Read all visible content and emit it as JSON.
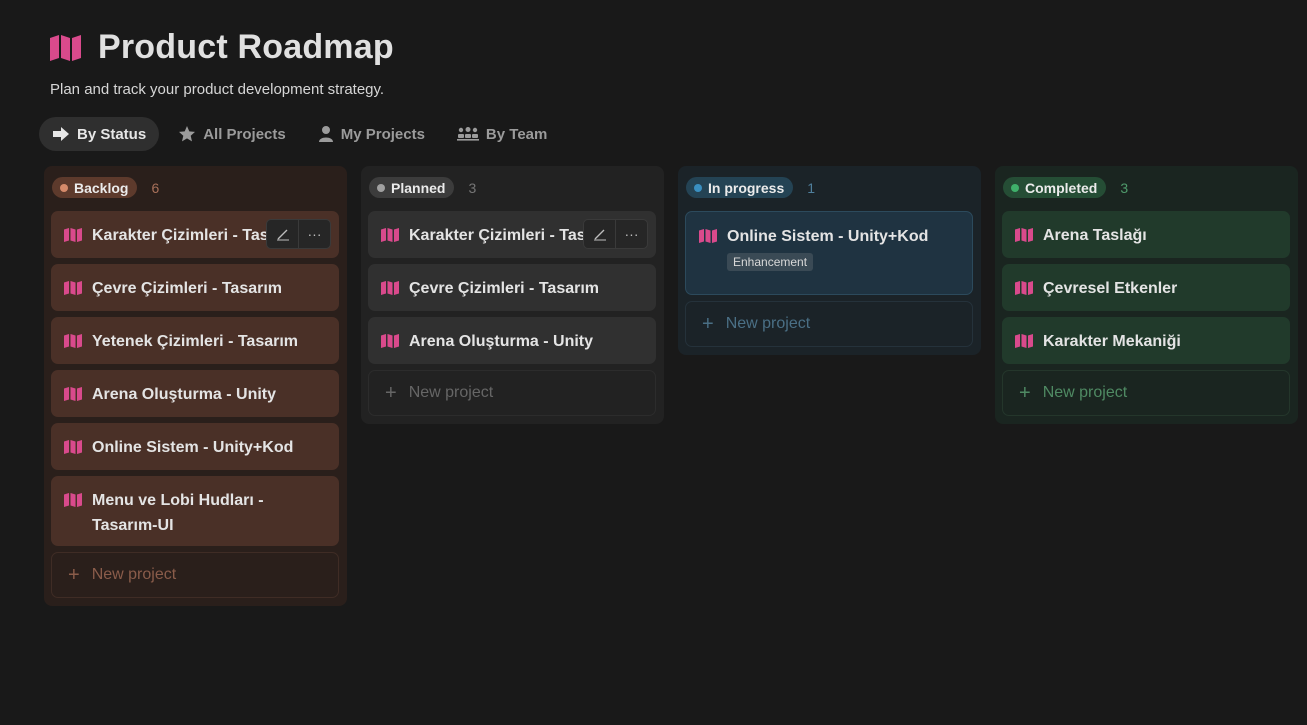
{
  "page": {
    "title": "Product Roadmap",
    "subtitle": "Plan and track your product development strategy.",
    "title_icon": "map-icon"
  },
  "views": [
    {
      "label": "By Status",
      "icon": "arrow-right-icon",
      "active": true
    },
    {
      "label": "All Projects",
      "icon": "star-icon",
      "active": false
    },
    {
      "label": "My Projects",
      "icon": "person-icon",
      "active": false
    },
    {
      "label": "By Team",
      "icon": "team-icon",
      "active": false
    }
  ],
  "columns": [
    {
      "name": "Backlog",
      "count": "6",
      "colors": {
        "bg": "#2a1f1b",
        "pill": "#5d3a2c",
        "dot": "#d58a6a",
        "card": "#4a3027",
        "count": "#a8705a",
        "new": "#8a5c4a",
        "newBorder": "#3f2c25"
      },
      "cards": [
        {
          "title": "Karakter Çizimleri - Tasarım",
          "hover": true
        },
        {
          "title": "Çevre Çizimleri - Tasarım"
        },
        {
          "title": " Yetenek Çizimleri - Tasarım"
        },
        {
          "title": "Arena Oluşturma - Unity"
        },
        {
          "title": "Online Sistem - Unity+Kod"
        },
        {
          "title": "Menu ve Lobi Hudları - Tasarım-UI",
          "wrap": true
        }
      ],
      "new_label": "New project"
    },
    {
      "name": "Planned",
      "count": "3",
      "colors": {
        "bg": "#222222",
        "pill": "#3c3c3c",
        "dot": "#a0a0a0",
        "card": "#303030",
        "count": "#767676",
        "new": "#666666",
        "newBorder": "#2c2c2c"
      },
      "cards": [
        {
          "title": "Karakter Çizimleri - Tasarım",
          "hover": true
        },
        {
          "title": "Çevre Çizimleri - Tasarım"
        },
        {
          "title": "Arena Oluşturma - Unity"
        }
      ],
      "new_label": "New project"
    },
    {
      "name": "In progress",
      "count": "1",
      "colors": {
        "bg": "#1b2328",
        "pill": "#244354",
        "dot": "#3a8fc0",
        "card": "#1f3341",
        "count": "#4f7f9c",
        "new": "#4a6f85",
        "newBorder": "#25323b"
      },
      "cards": [
        {
          "title": "Online Sistem - Unity+Kod",
          "tag": "Enhancement"
        }
      ],
      "new_label": "New project"
    },
    {
      "name": "Completed",
      "count": "3",
      "colors": {
        "bg": "#1a2520",
        "pill": "#254d35",
        "dot": "#3fb06a",
        "card": "#213a2b",
        "count": "#4f9a6b",
        "new": "#4f8a63",
        "newBorder": "#24362b"
      },
      "cards": [
        {
          "title": "Arena Taslağı"
        },
        {
          "title": "Çevresel Etkenler"
        },
        {
          "title": "Karakter Mekaniği"
        }
      ],
      "new_label": "New project"
    }
  ],
  "card_actions": {
    "edit_icon": "pencil-icon",
    "more_label": "···",
    "more_icon": "more-icon"
  },
  "accent_color": "#d94a8c"
}
